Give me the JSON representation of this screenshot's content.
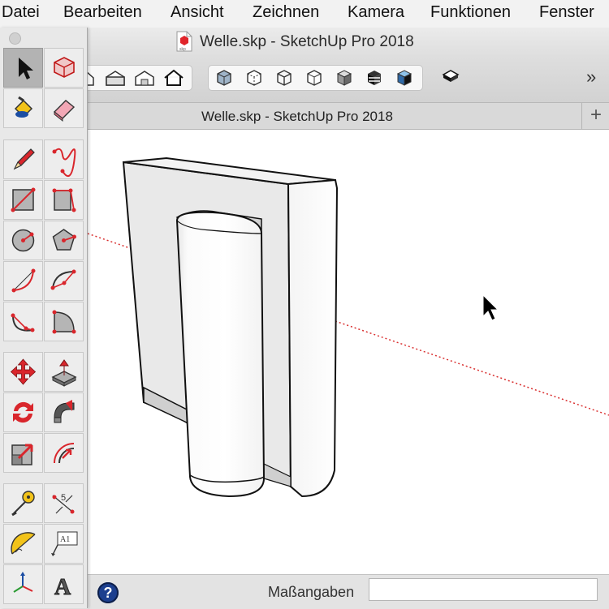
{
  "menu": {
    "items": [
      "Datei",
      "Bearbeiten",
      "Ansicht",
      "Zeichnen",
      "Kamera",
      "Funktionen",
      "Fenster"
    ]
  },
  "window": {
    "title": "Welle.skp - SketchUp Pro 2018"
  },
  "toolbar": {
    "views": [
      "home-view",
      "front-view",
      "back-view",
      "house-outline-view"
    ],
    "styles": [
      "x-ray-style",
      "back-edges-style",
      "wireframe-style",
      "hidden-line-style",
      "shaded-style",
      "shaded-textures-style",
      "monochrome-style"
    ],
    "extra": [
      "section-plane"
    ],
    "overflow": "»"
  },
  "tab": {
    "label": "Welle.skp - SketchUp Pro 2018",
    "new_tab": "+"
  },
  "status": {
    "help": "?",
    "measure_label": "Maßangaben",
    "measure_value": ""
  },
  "palette": {
    "tools": [
      {
        "row": 0,
        "col": 0,
        "name": "select-tool",
        "active": true
      },
      {
        "row": 0,
        "col": 1,
        "name": "component-tool",
        "active": false
      },
      {
        "row": 1,
        "col": 0,
        "name": "paint-bucket-tool",
        "active": false
      },
      {
        "row": 1,
        "col": 1,
        "name": "eraser-tool",
        "active": false
      },
      {
        "row": 2,
        "col": 0,
        "name": "pencil-line-tool",
        "active": false
      },
      {
        "row": 2,
        "col": 1,
        "name": "freehand-tool",
        "active": false
      },
      {
        "row": 3,
        "col": 0,
        "name": "rectangle-tool",
        "active": false
      },
      {
        "row": 3,
        "col": 1,
        "name": "rotated-rectangle-tool",
        "active": false
      },
      {
        "row": 4,
        "col": 0,
        "name": "circle-tool",
        "active": false
      },
      {
        "row": 4,
        "col": 1,
        "name": "polygon-tool",
        "active": false
      },
      {
        "row": 5,
        "col": 0,
        "name": "arc-tool",
        "active": false
      },
      {
        "row": 5,
        "col": 1,
        "name": "2-point-arc-tool",
        "active": false
      },
      {
        "row": 6,
        "col": 0,
        "name": "3-point-arc-tool",
        "active": false
      },
      {
        "row": 6,
        "col": 1,
        "name": "pie-tool",
        "active": false
      },
      {
        "row": 7,
        "col": 0,
        "name": "move-tool",
        "active": false
      },
      {
        "row": 7,
        "col": 1,
        "name": "push-pull-tool",
        "active": false
      },
      {
        "row": 8,
        "col": 0,
        "name": "rotate-tool",
        "active": false
      },
      {
        "row": 8,
        "col": 1,
        "name": "follow-me-tool",
        "active": false
      },
      {
        "row": 9,
        "col": 0,
        "name": "scale-tool",
        "active": false
      },
      {
        "row": 9,
        "col": 1,
        "name": "offset-tool",
        "active": false
      },
      {
        "row": 10,
        "col": 0,
        "name": "tape-measure-tool",
        "active": false
      },
      {
        "row": 10,
        "col": 1,
        "name": "dimension-tool",
        "active": false
      },
      {
        "row": 11,
        "col": 0,
        "name": "protractor-tool",
        "active": false
      },
      {
        "row": 11,
        "col": 1,
        "name": "text-tool",
        "active": false
      },
      {
        "row": 12,
        "col": 0,
        "name": "axes-tool",
        "active": false
      },
      {
        "row": 12,
        "col": 1,
        "name": "3d-text-tool",
        "active": false
      }
    ],
    "dimension_text": "5",
    "text_tool_text": "A1",
    "threed_text_glyph": "A"
  },
  "colors": {
    "accent_red": "#e0252b",
    "axis_red_dotted": "#d93030",
    "help_blue": "#1c3f8f",
    "active_tool": "#b3b3b3"
  }
}
